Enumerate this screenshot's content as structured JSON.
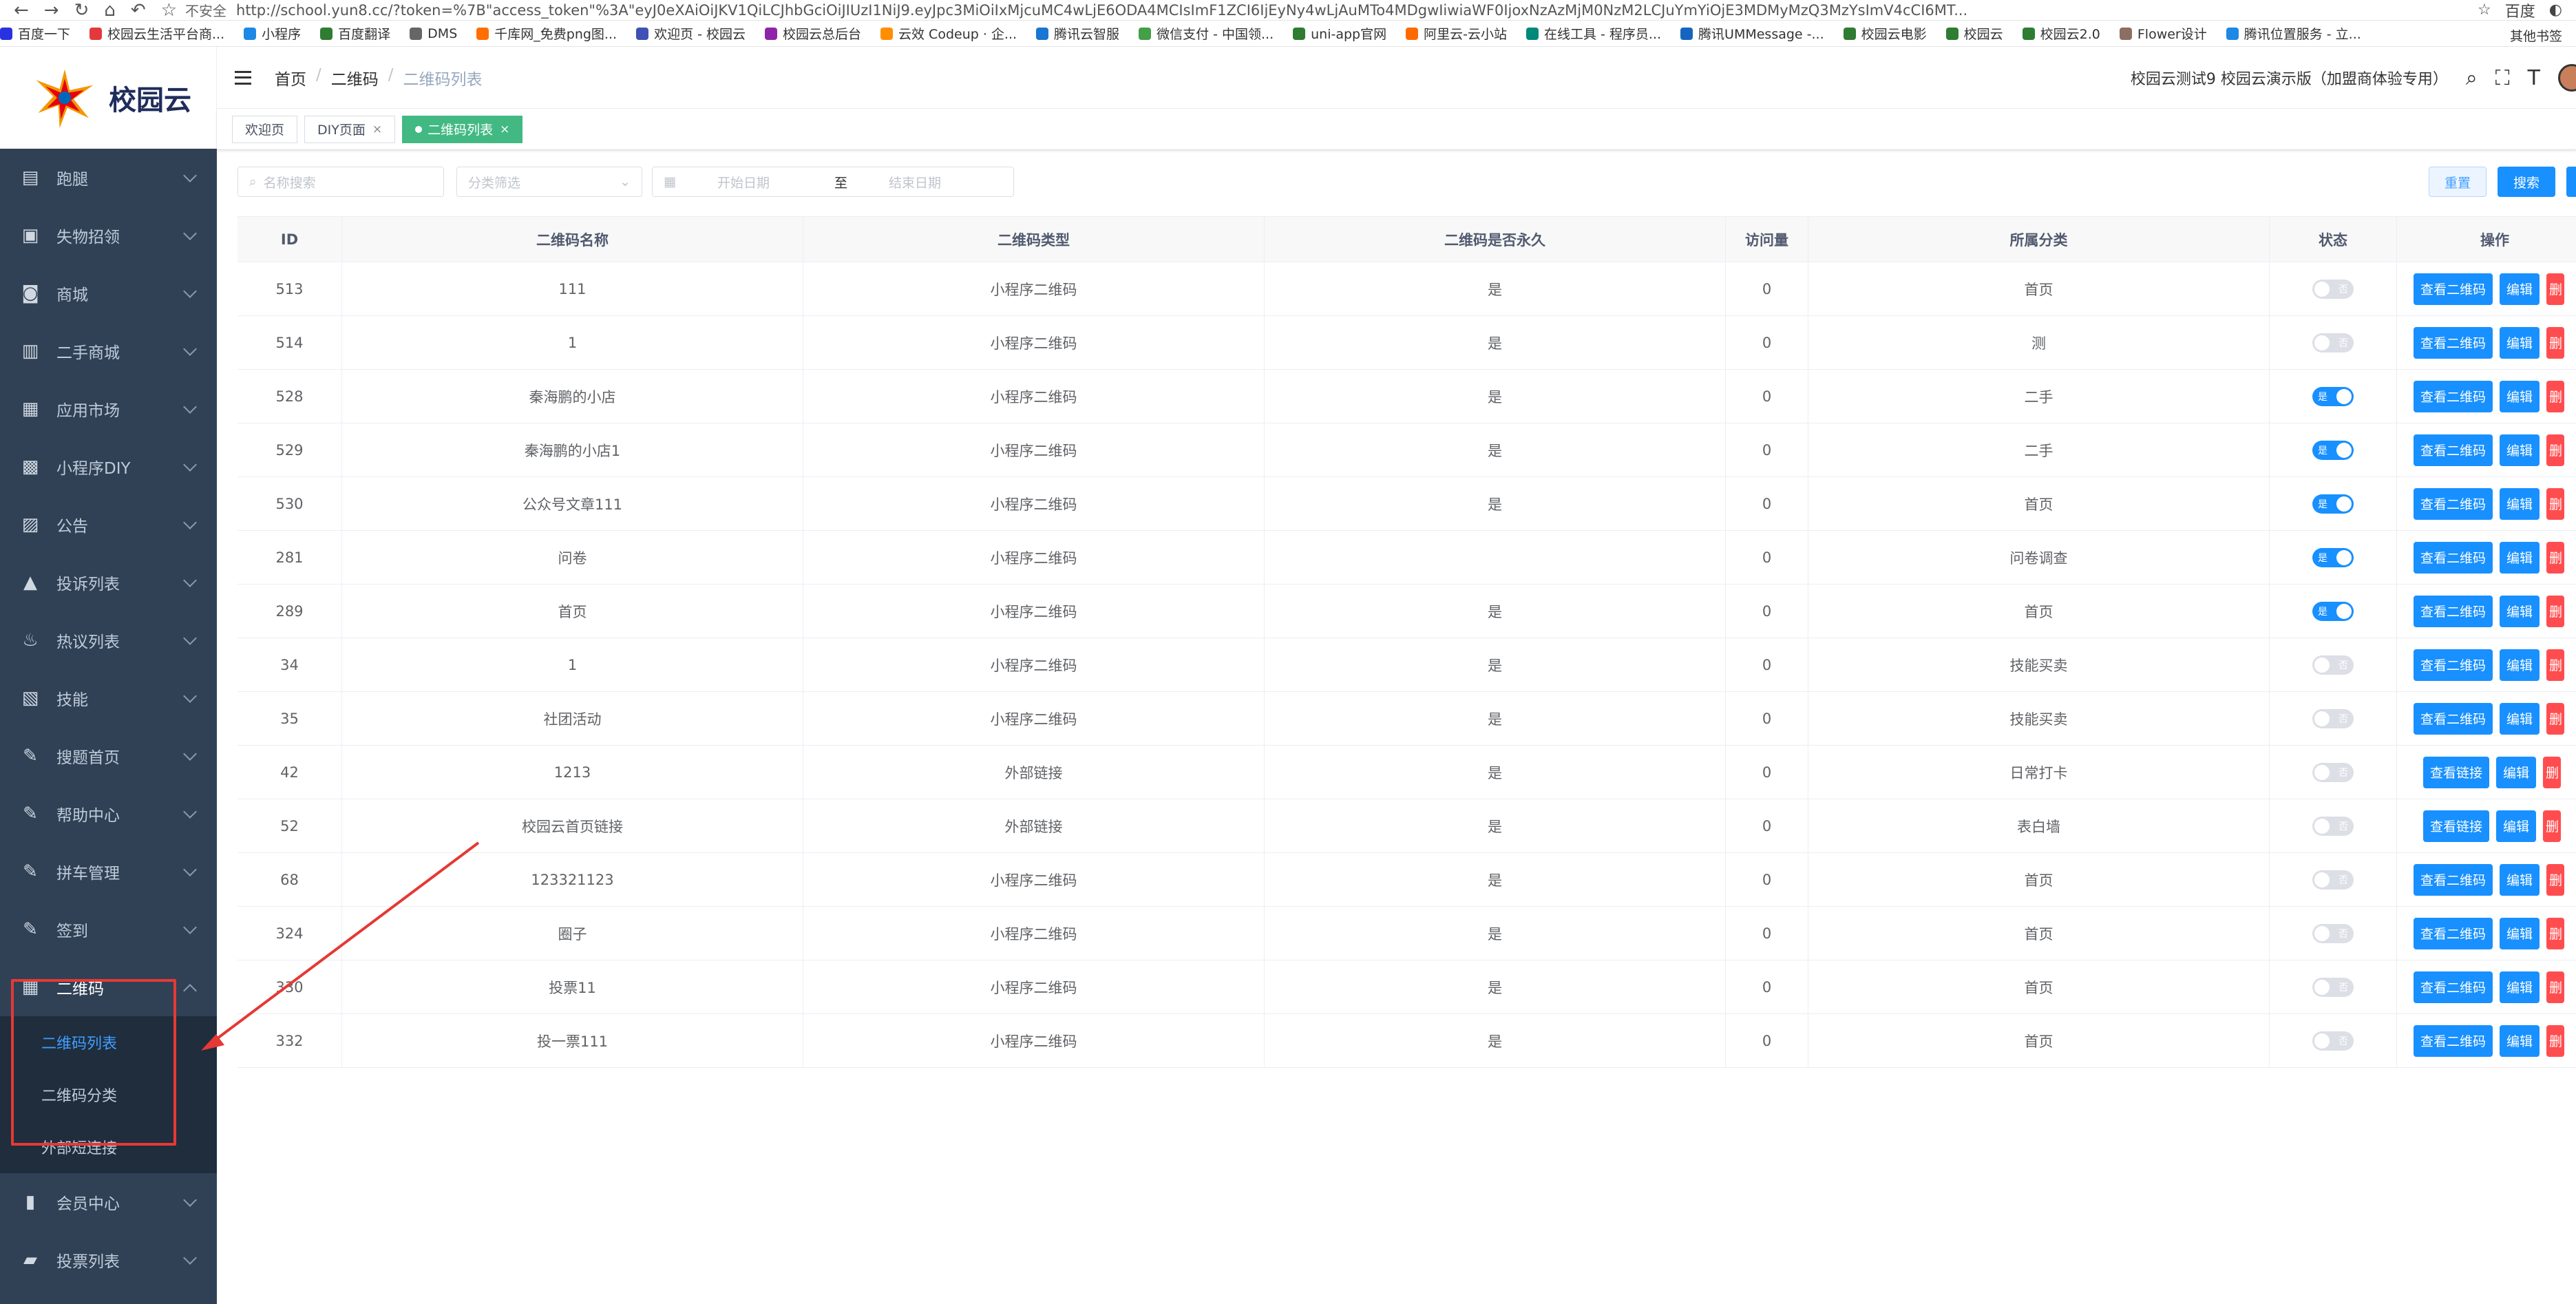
{
  "browser": {
    "security": "不安全",
    "url": "http://school.yun8.cc/?token=%7B\"access_token\"%3A\"eyJ0eXAiOiJKV1QiLCJhbGciOiJIUzI1NiJ9.eyJpc3MiOiIxMjcuMC4wLjE6ODA4MCIsImF1ZCI6IjEyNy4wLjAuMTo4MDgwIiwiaWF0IjoxNzAzMjM0NzM2LCJuYmYiOjE3MDMyMzQ3MzYsImV4cCI6MT...",
    "search_engine": "百度",
    "bookmarks": [
      "百度一下",
      "校园云生活平台商...",
      "小程序",
      "百度翻译",
      "DMS",
      "千库网_免费png图...",
      "欢迎页 - 校园云",
      "校园云总后台",
      "云效 Codeup · 企...",
      "腾讯云智服",
      "微信支付 - 中国领...",
      "uni-app官网",
      "阿里云-云小站",
      "在线工具 - 程序员...",
      "腾讯UMMessage -...",
      "校园云电影",
      "校园云",
      "校园云2.0",
      "Flower设计",
      "腾讯位置服务 - 立..."
    ],
    "other_bookmarks": "其他书签"
  },
  "logo_text": "校园云",
  "sidebar": {
    "items": [
      {
        "label": "跑腿",
        "icon": "clipboard-icon"
      },
      {
        "label": "失物招领",
        "icon": "box-icon"
      },
      {
        "label": "商城",
        "icon": "shop-bag-icon"
      },
      {
        "label": "二手商城",
        "icon": "store-icon"
      },
      {
        "label": "应用市场",
        "icon": "grid-icon"
      },
      {
        "label": "小程序DIY",
        "icon": "apps-icon"
      },
      {
        "label": "公告",
        "icon": "notice-icon"
      },
      {
        "label": "投诉列表",
        "icon": "warning-icon"
      },
      {
        "label": "热议列表",
        "icon": "fire-icon"
      },
      {
        "label": "技能",
        "icon": "id-card-icon"
      },
      {
        "label": "搜题首页",
        "icon": "edit-doc-icon"
      },
      {
        "label": "帮助中心",
        "icon": "edit-doc-icon"
      },
      {
        "label": "拼车管理",
        "icon": "edit-doc-icon"
      },
      {
        "label": "签到",
        "icon": "edit-doc-icon"
      }
    ],
    "open_item": {
      "label": "二维码",
      "icon": "qrcode-doc-icon"
    },
    "sub_items": [
      "二维码列表",
      "二维码分类"
    ],
    "extra_sub": "外部短连接",
    "bottom_items": [
      {
        "label": "会员中心",
        "icon": "book-icon"
      },
      {
        "label": "投票列表",
        "icon": "vote-box-icon"
      }
    ]
  },
  "header": {
    "breadcrumb": [
      "首页",
      "二维码",
      "二维码列表"
    ],
    "user_text": "校园云测试9 校园云演示版（加盟商体验专用）"
  },
  "tags": [
    {
      "label": "欢迎页",
      "closable": false,
      "active": false
    },
    {
      "label": "DIY页面",
      "closable": true,
      "active": false
    },
    {
      "label": "二维码列表",
      "closable": true,
      "active": true
    }
  ],
  "filters": {
    "name_placeholder": "名称搜索",
    "category_placeholder": "分类筛选",
    "start_placeholder": "开始日期",
    "range_sep": "至",
    "end_placeholder": "结束日期",
    "reset_label": "重置",
    "search_label": "搜索"
  },
  "table": {
    "headers": [
      "ID",
      "二维码名称",
      "二维码类型",
      "二维码是否永久",
      "访问量",
      "所属分类",
      "状态",
      "操作"
    ],
    "switch_on_text": "是",
    "switch_off_text": "否",
    "rows": [
      {
        "id": "513",
        "name": "111",
        "type": "小程序二维码",
        "perm": "是",
        "visits": "0",
        "cat": "首页",
        "status": false,
        "view": "查看二维码"
      },
      {
        "id": "514",
        "name": "1",
        "type": "小程序二维码",
        "perm": "是",
        "visits": "0",
        "cat": "测",
        "status": false,
        "view": "查看二维码"
      },
      {
        "id": "528",
        "name": "秦海鹏的小店",
        "type": "小程序二维码",
        "perm": "是",
        "visits": "0",
        "cat": "二手",
        "status": true,
        "view": "查看二维码"
      },
      {
        "id": "529",
        "name": "秦海鹏的小店1",
        "type": "小程序二维码",
        "perm": "是",
        "visits": "0",
        "cat": "二手",
        "status": true,
        "view": "查看二维码"
      },
      {
        "id": "530",
        "name": "公众号文章111",
        "type": "小程序二维码",
        "perm": "是",
        "visits": "0",
        "cat": "首页",
        "status": true,
        "view": "查看二维码"
      },
      {
        "id": "281",
        "name": "问卷",
        "type": "小程序二维码",
        "perm": "",
        "visits": "0",
        "cat": "问卷调查",
        "status": true,
        "view": "查看二维码"
      },
      {
        "id": "289",
        "name": "首页",
        "type": "小程序二维码",
        "perm": "是",
        "visits": "0",
        "cat": "首页",
        "status": true,
        "view": "查看二维码"
      },
      {
        "id": "34",
        "name": "1",
        "type": "小程序二维码",
        "perm": "是",
        "visits": "0",
        "cat": "技能买卖",
        "status": false,
        "view": "查看二维码"
      },
      {
        "id": "35",
        "name": "社团活动",
        "type": "小程序二维码",
        "perm": "是",
        "visits": "0",
        "cat": "技能买卖",
        "status": false,
        "view": "查看二维码"
      },
      {
        "id": "42",
        "name": "1213",
        "type": "外部链接",
        "perm": "是",
        "visits": "0",
        "cat": "日常打卡",
        "status": false,
        "view": "查看链接"
      },
      {
        "id": "52",
        "name": "校园云首页链接",
        "type": "外部链接",
        "perm": "是",
        "visits": "0",
        "cat": "表白墙",
        "status": false,
        "view": "查看链接"
      },
      {
        "id": "68",
        "name": "123321123",
        "type": "小程序二维码",
        "perm": "是",
        "visits": "0",
        "cat": "首页",
        "status": false,
        "view": "查看二维码"
      },
      {
        "id": "324",
        "name": "圈子",
        "type": "小程序二维码",
        "perm": "是",
        "visits": "0",
        "cat": "首页",
        "status": false,
        "view": "查看二维码"
      },
      {
        "id": "330",
        "name": "投票11",
        "type": "小程序二维码",
        "perm": "是",
        "visits": "0",
        "cat": "首页",
        "status": false,
        "view": "查看二维码"
      },
      {
        "id": "332",
        "name": "投一票111",
        "type": "小程序二维码",
        "perm": "是",
        "visits": "0",
        "cat": "首页",
        "status": false,
        "view": "查看二维码"
      }
    ],
    "edit_label": "编辑",
    "delete_label": "删"
  },
  "colors": {
    "sidebar_bg": "#304156",
    "submenu_bg": "#1f2d3d",
    "primary": "#1890ff",
    "danger": "#ff4d4f",
    "active_tag": "#42b983",
    "annotation_red": "#e53935"
  }
}
